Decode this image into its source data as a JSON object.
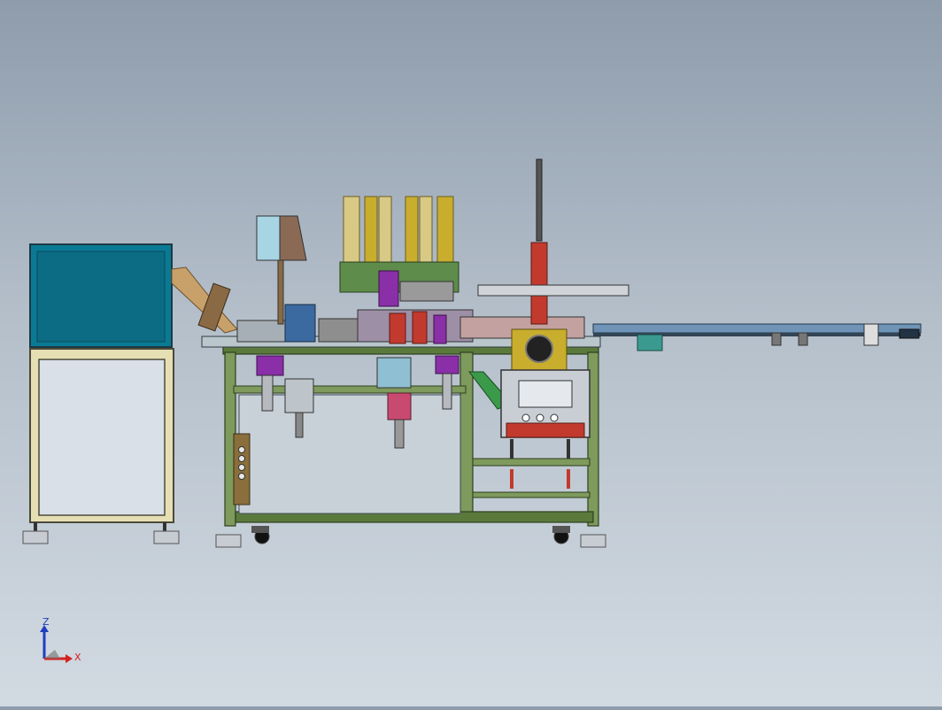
{
  "viewport": {
    "background_top": "#8e9cac",
    "background_bottom": "#d2dae2"
  },
  "triad": {
    "z_label": "Z",
    "x_label": "X",
    "z_color": "#1f3fbf",
    "x_color": "#d42020"
  },
  "model": {
    "frame_color": "#5a7a3c",
    "panel_color": "#0a7a94",
    "cabinet_color": "#e7dfb4",
    "accent_red": "#c23a2e",
    "accent_purple": "#8a2fa8",
    "accent_yellow": "#c9ad2d"
  }
}
